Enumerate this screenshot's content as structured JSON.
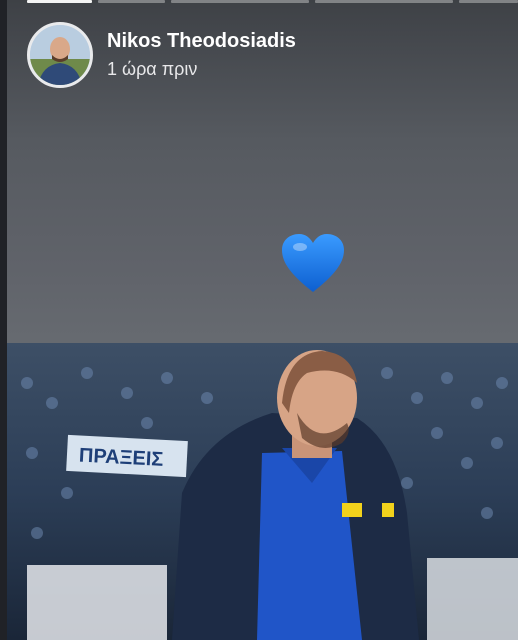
{
  "story": {
    "progress_segments": [
      {
        "state": "active"
      },
      {
        "state": "inactive"
      },
      {
        "state": "inactive"
      },
      {
        "state": "inactive"
      },
      {
        "state": "inactive"
      }
    ],
    "user_name": "Nikos Theodosiadis",
    "timestamp": "1 ώρα πριν",
    "reaction_icon": "blue-heart-icon",
    "banner_text": "ΠΡΑΞΕΙΣ",
    "colors": {
      "heart": "#1e78e6",
      "background": "#5f6268",
      "jacket": "#1d2b45",
      "polo": "#2055c8"
    }
  }
}
